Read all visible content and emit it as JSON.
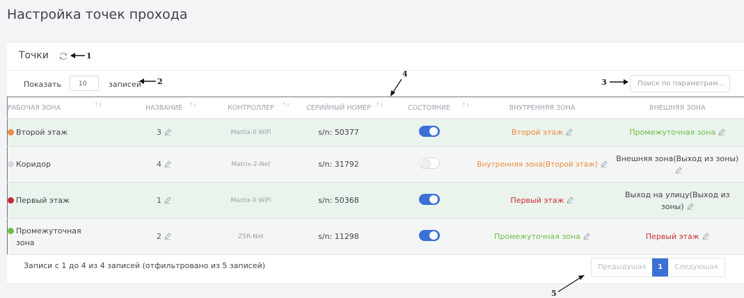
{
  "page": {
    "title": "Настройка точек прохода"
  },
  "card": {
    "title": "Точки",
    "show_label": "Показать",
    "page_size": "10",
    "records_label": "записей",
    "search_placeholder": "Поиск по параметрам..."
  },
  "annotations": {
    "a1": "1",
    "a2": "2",
    "a3": "3",
    "a4": "4",
    "a5": "5"
  },
  "table": {
    "headers": [
      "РАБОЧАЯ ЗОНА",
      "НАЗВАНИЕ",
      "КОНТРОЛЛЕР",
      "СЕРИЙНЫЙ НОМЕР",
      "СОСТОЯНИЕ",
      "ВНУТРЕННЯЯ ЗОНА",
      "ВНЕШНЯЯ ЗОНА"
    ],
    "rows": [
      {
        "zone": "Второй этаж",
        "zone_color": "#f0883e",
        "name": "3",
        "controller": "Martix-II WiFi",
        "serial": "s/n: 50377",
        "enabled": true,
        "inner": "Второй этаж",
        "inner_color": "#ef8a3c",
        "outer": "Промежуточная зона",
        "outer_color": "#6cbf45"
      },
      {
        "zone": "Коридор",
        "zone_color": "#d5d8dc",
        "name": "4",
        "controller": "Matrix-2-Net",
        "serial": "s/n: 31792",
        "enabled": false,
        "inner": "Внутренняя зона(Второй этаж)",
        "inner_color": "#ef8a3c",
        "outer": "Внешняя зона(Выход из зоны)",
        "outer_color": "#444444"
      },
      {
        "zone": "Первый этаж",
        "zone_color": "#c62a2a",
        "name": "1",
        "controller": "Martix-II WiFi",
        "serial": "s/n: 50368",
        "enabled": true,
        "inner": "Первый этаж",
        "inner_color": "#cc2f2f",
        "outer": "Выход на улицу(Выход из зоны)",
        "outer_color": "#444444"
      },
      {
        "zone": "Промежуточная зона",
        "zone_color": "#6cbf45",
        "name": "2",
        "controller": "Z5R-Net",
        "serial": "s/n: 11298",
        "enabled": true,
        "inner": "Промежуточная зона",
        "inner_color": "#6cbf45",
        "outer": "Первый этаж",
        "outer_color": "#cc2f2f"
      }
    ]
  },
  "footer": {
    "info": "Записи с 1 до 4 из 4 записей (отфильтровано из 5 записей)",
    "prev": "Предыдущая",
    "current_page": "1",
    "next": "Следующая"
  },
  "icons": {
    "refresh": "refresh-icon",
    "edit": "pencil-icon",
    "sort": "sort-arrows-icon"
  },
  "colors": {
    "accent": "#3b70d6",
    "row_bg": "#eaf3ec"
  }
}
